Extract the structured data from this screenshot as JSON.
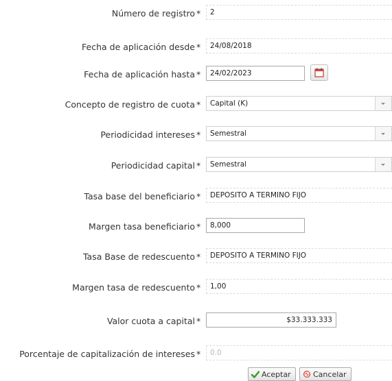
{
  "required_mark": "*",
  "fields": {
    "numero_registro": {
      "label": "Número de registro",
      "value": "2"
    },
    "fecha_desde": {
      "label": "Fecha de aplicación desde",
      "value": "24/08/2018"
    },
    "fecha_hasta": {
      "label": "Fecha de aplicación hasta",
      "value": "24/02/2023",
      "button_icon": "calendar-icon"
    },
    "concepto": {
      "label": "Concepto de registro de cuota",
      "value": "Capital (K)"
    },
    "periodicidad_intereses": {
      "label": "Periodicidad intereses",
      "value": "Semestral"
    },
    "periodicidad_capital": {
      "label": "Periodicidad capital",
      "value": "Semestral"
    },
    "tasa_base_beneficiario": {
      "label": "Tasa base del beneficiario",
      "value": "DEPOSITO A TERMINO FIJO"
    },
    "margen_tasa_beneficiario": {
      "label": "Margen tasa beneficiario",
      "value": "8,000"
    },
    "tasa_base_redescuento": {
      "label": "Tasa Base de redescuento",
      "value": "DEPOSITO A TERMINO FIJO"
    },
    "margen_tasa_redescuento": {
      "label": "Margen tasa de redescuento",
      "value": "1,00"
    },
    "valor_cuota_capital": {
      "label": "Valor cuota a capital",
      "value": "$33.333.333"
    },
    "porcentaje_capitalizacion": {
      "label": "Porcentaje de capitalización de intereses",
      "placeholder": "0.0"
    }
  },
  "buttons": {
    "accept": {
      "label": "Aceptar",
      "icon": "checkmark-icon",
      "color": "#3a9a2a"
    },
    "cancel": {
      "label": "Cancelar",
      "icon": "cancel-icon",
      "color": "#d8342c"
    }
  }
}
